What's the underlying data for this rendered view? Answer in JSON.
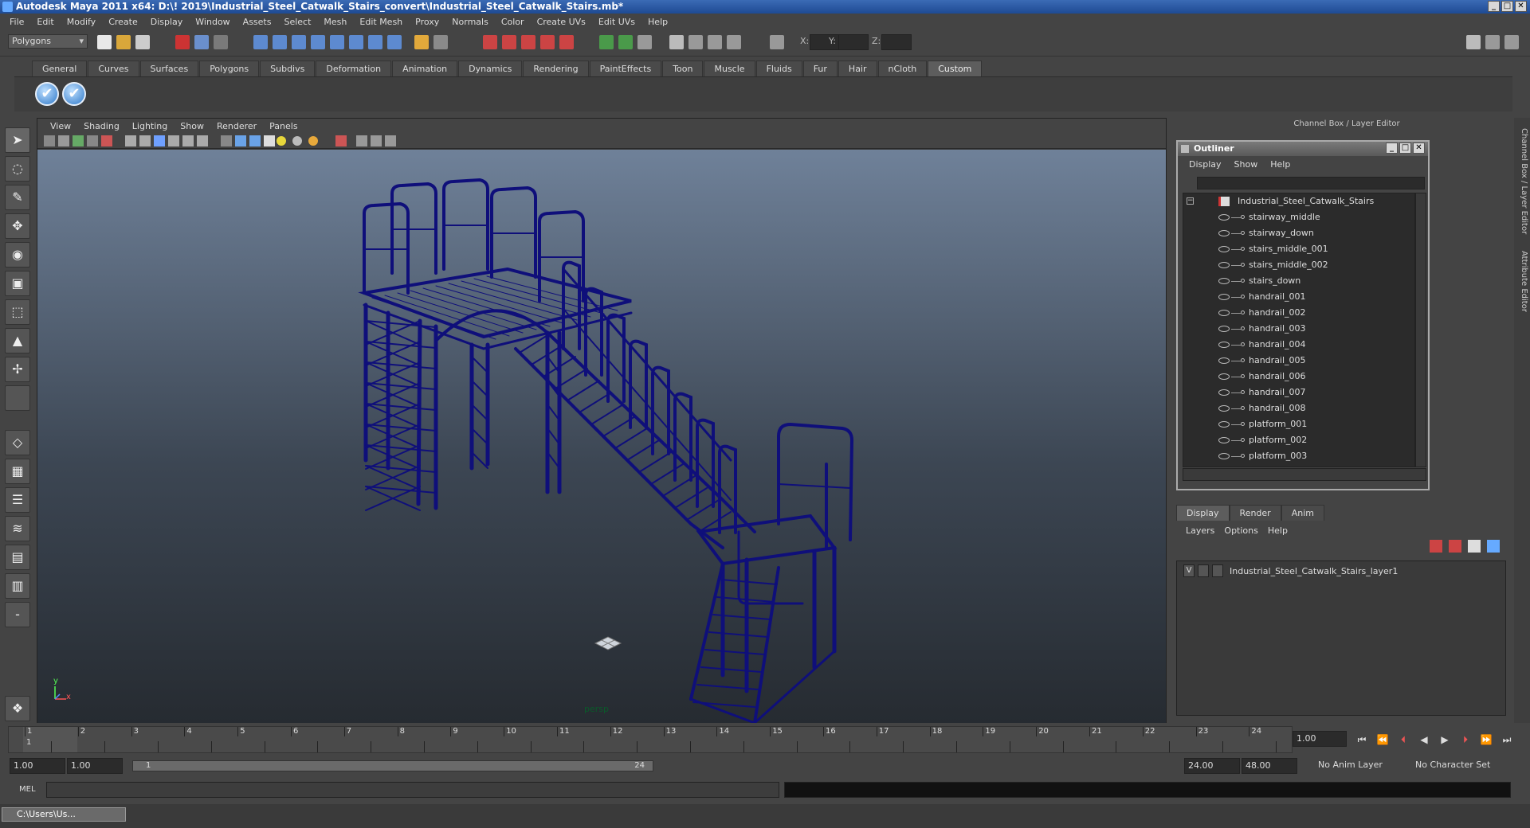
{
  "window": {
    "title": "Autodesk Maya 2011 x64: D:\\! 2019\\Industrial_Steel_Catwalk_Stairs_convert\\Industrial_Steel_Catwalk_Stairs.mb*",
    "min": "_",
    "max": "□",
    "close": "✕"
  },
  "menubar": [
    "File",
    "Edit",
    "Modify",
    "Create",
    "Display",
    "Window",
    "Assets",
    "Select",
    "Mesh",
    "Edit Mesh",
    "Proxy",
    "Normals",
    "Color",
    "Create UVs",
    "Edit UVs",
    "Help"
  ],
  "status": {
    "menuset": "Polygons",
    "x_label": "X:",
    "y_label": "Y:",
    "z_label": "Z:"
  },
  "shelf_tabs": [
    "General",
    "Curves",
    "Surfaces",
    "Polygons",
    "Subdivs",
    "Deformation",
    "Animation",
    "Dynamics",
    "Rendering",
    "PaintEffects",
    "Toon",
    "Muscle",
    "Fluids",
    "Fur",
    "Hair",
    "nCloth",
    "Custom"
  ],
  "shelf_active": "Custom",
  "shelf_buttons": [
    "✔",
    "✔"
  ],
  "viewport": {
    "menu": [
      "View",
      "Shading",
      "Lighting",
      "Show",
      "Renderer",
      "Panels"
    ],
    "camera": "persp",
    "axis_y": "y",
    "axis_x": "x",
    "axis_z": "z",
    "wire_color": "#0f0f7a"
  },
  "channel_box_title": "Channel Box / Layer Editor",
  "side_tabs": [
    "Channel Box / Layer Editor",
    "Attribute Editor"
  ],
  "outliner": {
    "title": "Outliner",
    "menu": [
      "Display",
      "Show",
      "Help"
    ],
    "root": "Industrial_Steel_Catwalk_Stairs",
    "items": [
      "stairway_middle",
      "stairway_down",
      "stairs_middle_001",
      "stairs_middle_002",
      "stairs_down",
      "handrail_001",
      "handrail_002",
      "handrail_003",
      "handrail_004",
      "handrail_005",
      "handrail_006",
      "handrail_007",
      "handrail_008",
      "platform_001",
      "platform_002",
      "platform_003"
    ]
  },
  "layer_editor": {
    "tabs": [
      "Display",
      "Render",
      "Anim"
    ],
    "menu": [
      "Layers",
      "Options",
      "Help"
    ],
    "layer_visible": "V",
    "layer_name": "Industrial_Steel_Catwalk_Stairs_layer1"
  },
  "timeline": {
    "ticks": [
      "1",
      "2",
      "3",
      "4",
      "5",
      "6",
      "7",
      "8",
      "9",
      "10",
      "11",
      "12",
      "13",
      "14",
      "15",
      "16",
      "17",
      "18",
      "19",
      "20",
      "21",
      "22",
      "23",
      "24"
    ],
    "current_frame": "1.00",
    "playhead": "1"
  },
  "range": {
    "start": "1.00",
    "inner_start": "1.00",
    "slider_start": "1",
    "slider_end": "24",
    "end": "24.00",
    "outer_end": "48.00",
    "anim_layer": "No Anim Layer",
    "char_set": "No Character Set"
  },
  "cmdline": {
    "label": "MEL"
  },
  "taskbar": {
    "window": "C:\\Users\\Us..."
  }
}
